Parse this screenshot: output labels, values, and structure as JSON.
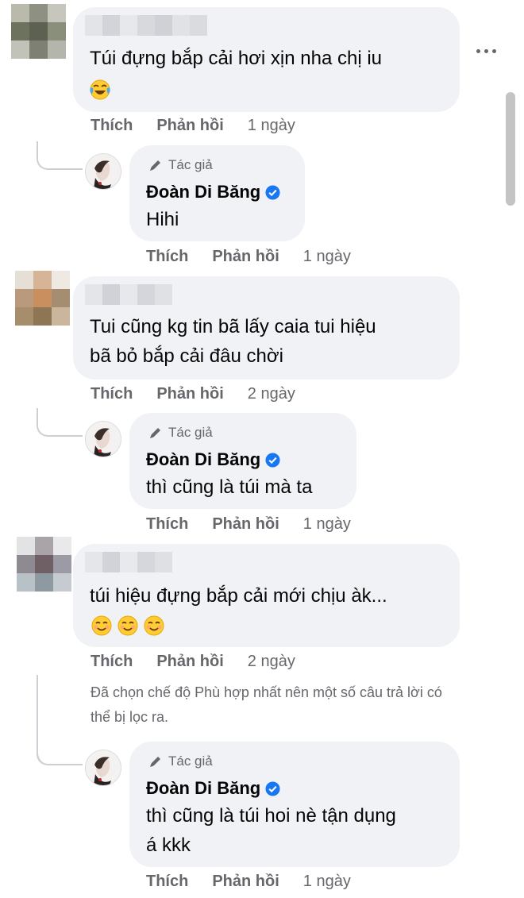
{
  "actions": {
    "like": "Thích",
    "reply": "Phản hồi"
  },
  "author": {
    "badge": "Tác giả",
    "name": "Đoàn Di Băng"
  },
  "comments": [
    {
      "text_lines": [
        "Túi đựng bắp cải hơi xịn nha chị iu"
      ],
      "emoji": [
        "face-with-tears-of-joy"
      ],
      "time": "1 ngày",
      "reply": {
        "text_lines": [
          "Hihi"
        ],
        "time": "1 ngày"
      }
    },
    {
      "text_lines": [
        "Tui cũng kg tin bã lấy caia tui hiệu",
        "bã bỏ bắp cải đâu chời"
      ],
      "time": "2 ngày",
      "reply": {
        "text_lines": [
          "thì cũng là túi mà ta"
        ],
        "time": "1 ngày"
      }
    },
    {
      "text_lines": [
        "túi hiệu đựng bắp cải mới chịu àk..."
      ],
      "emoji": [
        "smiling-face",
        "smiling-face",
        "smiling-face"
      ],
      "time": "2 ngày",
      "filter_note_lines": [
        "Đã chọn chế độ Phù hợp nhất nên một số câu trả lời có",
        "thể bị lọc ra."
      ],
      "reply": {
        "text_lines": [
          "thì cũng là túi hoi nè tận dụng",
          "á kkk"
        ],
        "time": "1 ngày"
      }
    }
  ],
  "colors": {
    "bubble": "#f0f2f5",
    "secondary_text": "#65676b",
    "verified_blue": "#1877f2",
    "thread_line": "#ccd0d5"
  }
}
